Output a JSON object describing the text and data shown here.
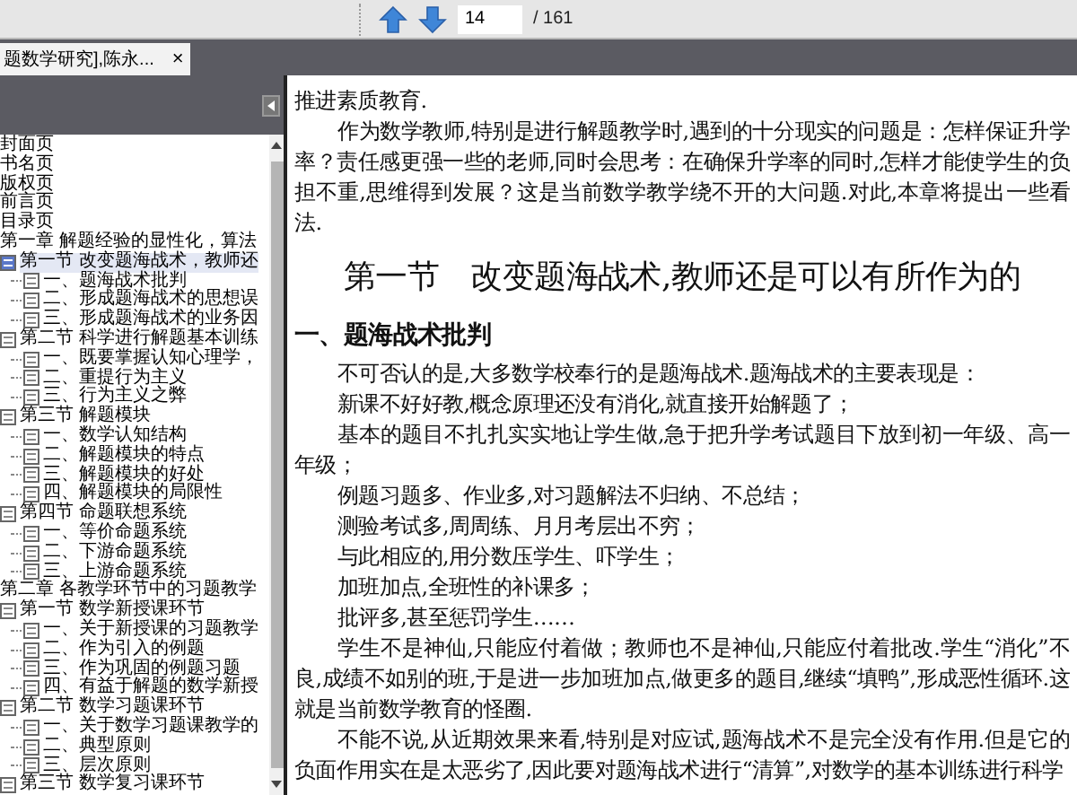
{
  "toolbar": {
    "page_input": "14",
    "page_total": "/ 161"
  },
  "tabs": [
    {
      "label": "题数学研究],陈永...",
      "close": "×",
      "selected": true
    }
  ],
  "bookmarks": [
    {
      "label": "封面页",
      "selected": false
    },
    {
      "label": "书名页",
      "selected": false
    },
    {
      "label": "版权页",
      "selected": false
    },
    {
      "label": "前言页",
      "selected": false
    },
    {
      "label": "目录页",
      "selected": false
    },
    {
      "label": "第一章 解题经验的显性化，算法",
      "selected": false,
      "children": [
        {
          "label": "第一节 改变题海战术，教师还",
          "selected": true,
          "children": [
            {
              "label": "一、题海战术批判",
              "selected": false
            },
            {
              "label": "二、形成题海战术的思想误",
              "selected": false
            },
            {
              "label": "三、形成题海战术的业务因",
              "selected": false
            }
          ]
        },
        {
          "label": "第二节 科学进行解题基本训练",
          "selected": false,
          "children": [
            {
              "label": "一、既要掌握认知心理学，",
              "selected": false
            },
            {
              "label": "二、重提行为主义",
              "selected": false
            },
            {
              "label": "三、行为主义之弊",
              "selected": false
            }
          ]
        },
        {
          "label": "第三节 解题模块",
          "selected": false,
          "children": [
            {
              "label": "一、数学认知结构",
              "selected": false
            },
            {
              "label": "二、解题模块的特点",
              "selected": false
            },
            {
              "label": "三、解题模块的好处",
              "selected": false
            },
            {
              "label": "四、解题模块的局限性",
              "selected": false
            }
          ]
        },
        {
          "label": "第四节 命题联想系统",
          "selected": false,
          "children": [
            {
              "label": "一、等价命题系统",
              "selected": false
            },
            {
              "label": "二、下游命题系统",
              "selected": false
            },
            {
              "label": "三、上游命题系统",
              "selected": false
            }
          ]
        }
      ]
    },
    {
      "label": "第二章 各教学环节中的习题教学",
      "selected": false,
      "children": [
        {
          "label": "第一节 数学新授课环节",
          "selected": false,
          "children": [
            {
              "label": "一、关于新授课的习题教学",
              "selected": false
            },
            {
              "label": "二、作为引入的例题",
              "selected": false
            },
            {
              "label": "三、作为巩固的例题习题",
              "selected": false
            },
            {
              "label": "四、有益于解题的数学新授",
              "selected": false
            }
          ]
        },
        {
          "label": "第二节 数学习题课环节",
          "selected": false,
          "children": [
            {
              "label": "一、关于数学习题课教学的",
              "selected": false
            },
            {
              "label": "二、典型原则",
              "selected": false
            },
            {
              "label": "三、层次原则",
              "selected": false
            }
          ]
        },
        {
          "label": "第三节 数学复习课环节",
          "selected": false
        }
      ]
    }
  ],
  "document": [
    {
      "kind": "plain",
      "text": "推进素质教育."
    },
    {
      "kind": "paragraph",
      "text": "作为数学教师,特别是进行解题教学时,遇到的十分现实的问题是：怎样保证升学率？责任感更强一些的老师,同时会思考：在确保升学率的同时,怎样才能使学生的负担不重,思维得到发展？这是当前数学教学绕不开的大问题.对此,本章将提出一些看法."
    },
    {
      "kind": "heading",
      "text": "第一节　改变题海战术,教师还是可以有所作为的"
    },
    {
      "kind": "subheading",
      "text": "一、题海战术批判"
    },
    {
      "kind": "paragraph",
      "text": "不可否认的是,大多数学校奉行的是题海战术.题海战术的主要表现是："
    },
    {
      "kind": "paragraph",
      "text": "新课不好好教,概念原理还没有消化,就直接开始解题了；"
    },
    {
      "kind": "paragraph",
      "text": "基本的题目不扎扎实实地让学生做,急于把升学考试题目下放到初一年级、高一年级；"
    },
    {
      "kind": "paragraph",
      "text": "例题习题多、作业多,对习题解法不归纳、不总结；"
    },
    {
      "kind": "paragraph",
      "text": "测验考试多,周周练、月月考层出不穷；"
    },
    {
      "kind": "paragraph",
      "text": "与此相应的,用分数压学生、吓学生；"
    },
    {
      "kind": "paragraph",
      "text": "加班加点,全班性的补课多；"
    },
    {
      "kind": "paragraph",
      "text": "批评多,甚至惩罚学生……"
    },
    {
      "kind": "paragraph",
      "text": "学生不是神仙,只能应付着做；教师也不是神仙,只能应付着批改.学生“消化”不良,成绩不如别的班,于是进一步加班加点,做更多的题目,继续“填鸭”,形成恶性循环.这就是当前数学教育的怪圈."
    },
    {
      "kind": "paragraph",
      "text": "不能不说,从近期效果来看,特别是对应试,题海战术不是完全没有作用.但是它的负面作用实在是太恶劣了,因此要对题海战术进行“清算”,对数学的基本训练进行科学"
    }
  ]
}
